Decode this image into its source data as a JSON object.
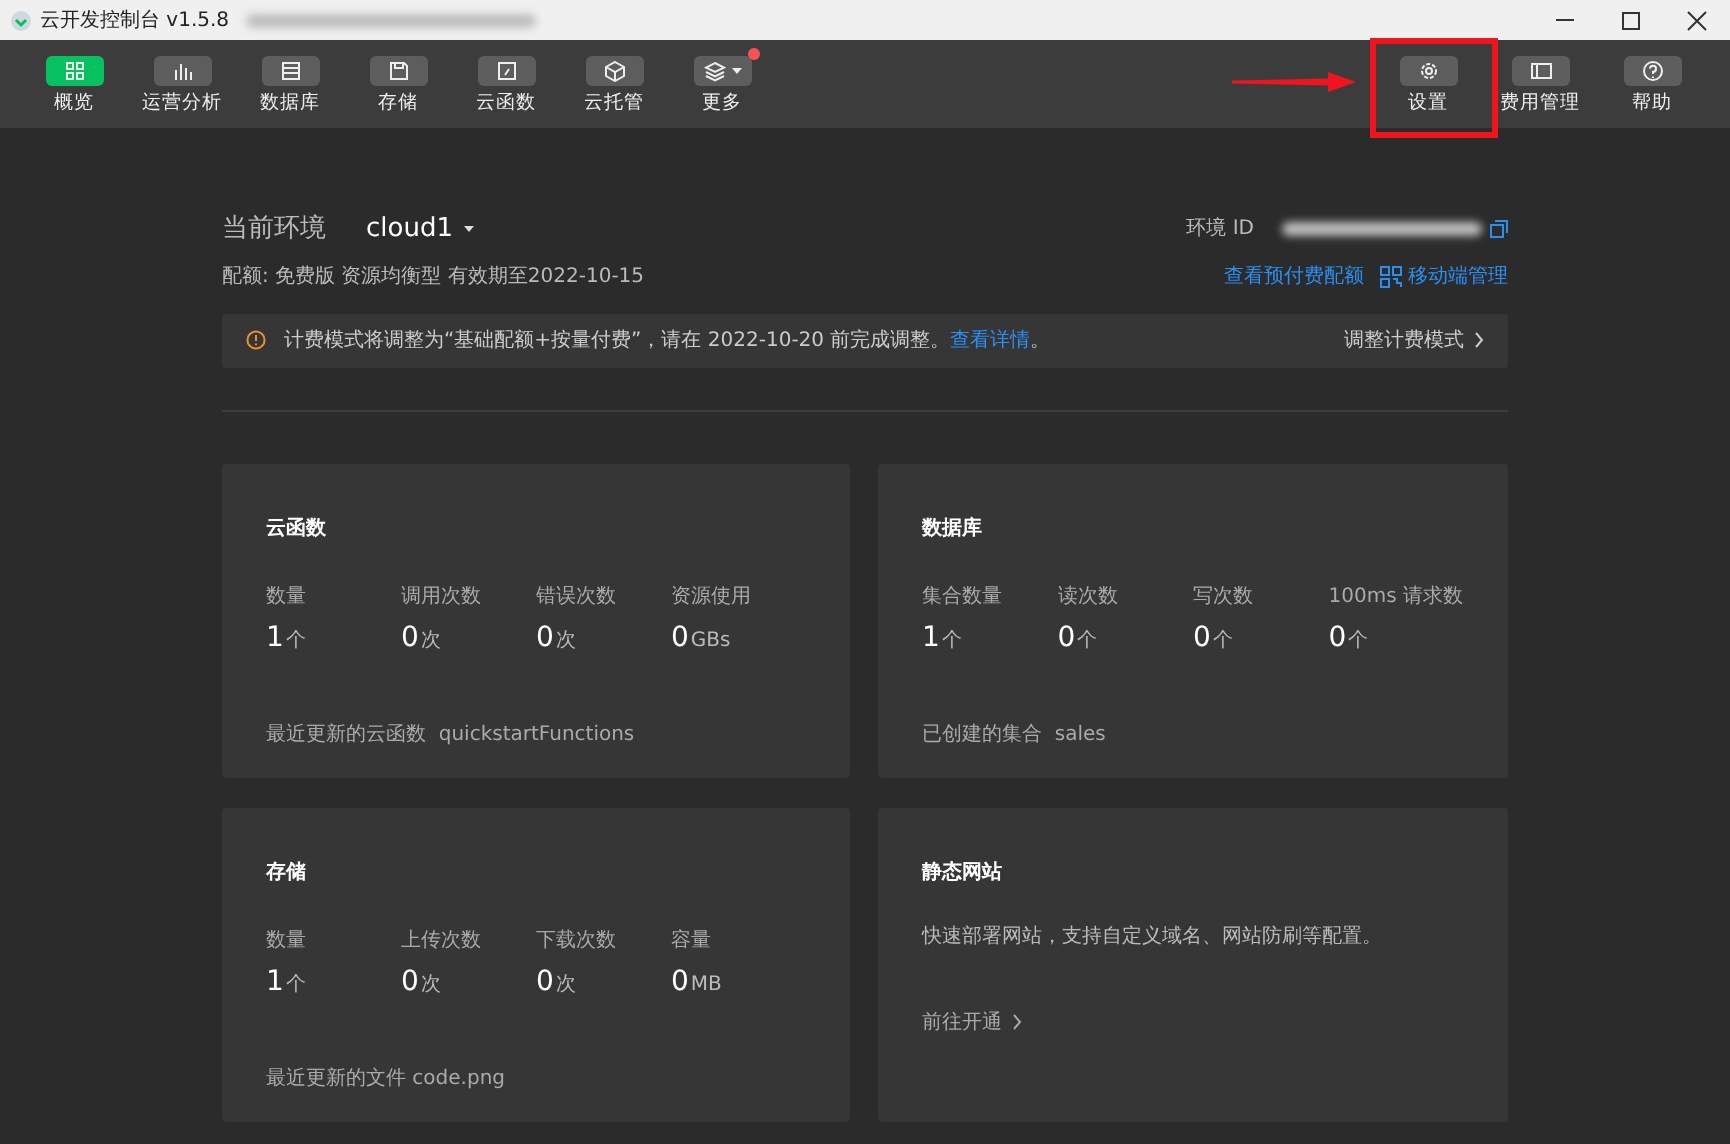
{
  "window": {
    "title": "云开发控制台 v1.5.8"
  },
  "toolbar": {
    "left": [
      {
        "label": "概览",
        "selected": true,
        "badge": false,
        "caret": false
      },
      {
        "label": "运营分析",
        "selected": false,
        "badge": false,
        "caret": false
      },
      {
        "label": "数据库",
        "selected": false,
        "badge": false,
        "caret": false
      },
      {
        "label": "存储",
        "selected": false,
        "badge": false,
        "caret": false
      },
      {
        "label": "云函数",
        "selected": false,
        "badge": false,
        "caret": false
      },
      {
        "label": "云托管",
        "selected": false,
        "badge": false,
        "caret": false
      },
      {
        "label": "更多",
        "selected": false,
        "badge": true,
        "caret": true
      }
    ],
    "right": [
      {
        "label": "设置",
        "selected": false,
        "badge": false,
        "caret": false,
        "highlighted": true
      },
      {
        "label": "费用管理",
        "selected": false,
        "badge": false,
        "caret": false,
        "highlighted": false
      },
      {
        "label": "帮助",
        "selected": false,
        "badge": false,
        "caret": false,
        "highlighted": false
      }
    ]
  },
  "environment": {
    "label": "当前环境",
    "name": "cloud1",
    "id_label": "环境 ID",
    "quota": "配额: 免费版 资源均衡型 有效期至2022-10-15",
    "links": [
      "查看预付费配额",
      "移动端管理"
    ]
  },
  "notice": {
    "text": "计费模式将调整为“基础配额+按量付费”，请在 2022-10-20 前完成调整。",
    "link": "查看详情",
    "after": "。",
    "action": "调整计费模式"
  },
  "cards": [
    {
      "title": "云函数",
      "stats": [
        {
          "label": "数量",
          "value": "1",
          "unit": "个"
        },
        {
          "label": "调用次数",
          "value": "0",
          "unit": "次"
        },
        {
          "label": "错误次数",
          "value": "0",
          "unit": "次"
        },
        {
          "label": "资源使用",
          "value": "0",
          "unit": "GBs"
        }
      ],
      "footer": "最近更新的云函数  quickstartFunctions"
    },
    {
      "title": "数据库",
      "stats": [
        {
          "label": "集合数量",
          "value": "1",
          "unit": "个"
        },
        {
          "label": "读次数",
          "value": "0",
          "unit": "个"
        },
        {
          "label": "写次数",
          "value": "0",
          "unit": "个"
        },
        {
          "label": "100ms 请求数",
          "value": "0",
          "unit": "个"
        }
      ],
      "footer": "已创建的集合  sales"
    },
    {
      "title": "存储",
      "stats": [
        {
          "label": "数量",
          "value": "1",
          "unit": "个"
        },
        {
          "label": "上传次数",
          "value": "0",
          "unit": "次"
        },
        {
          "label": "下载次数",
          "value": "0",
          "unit": "次"
        },
        {
          "label": "容量",
          "value": "0",
          "unit": "MB"
        }
      ],
      "footer": "最近更新的文件 code.png"
    },
    {
      "title": "静态网站",
      "description": "快速部署网站，支持自定义域名、网站防刷等配置。",
      "action": "前往开通"
    }
  ]
}
